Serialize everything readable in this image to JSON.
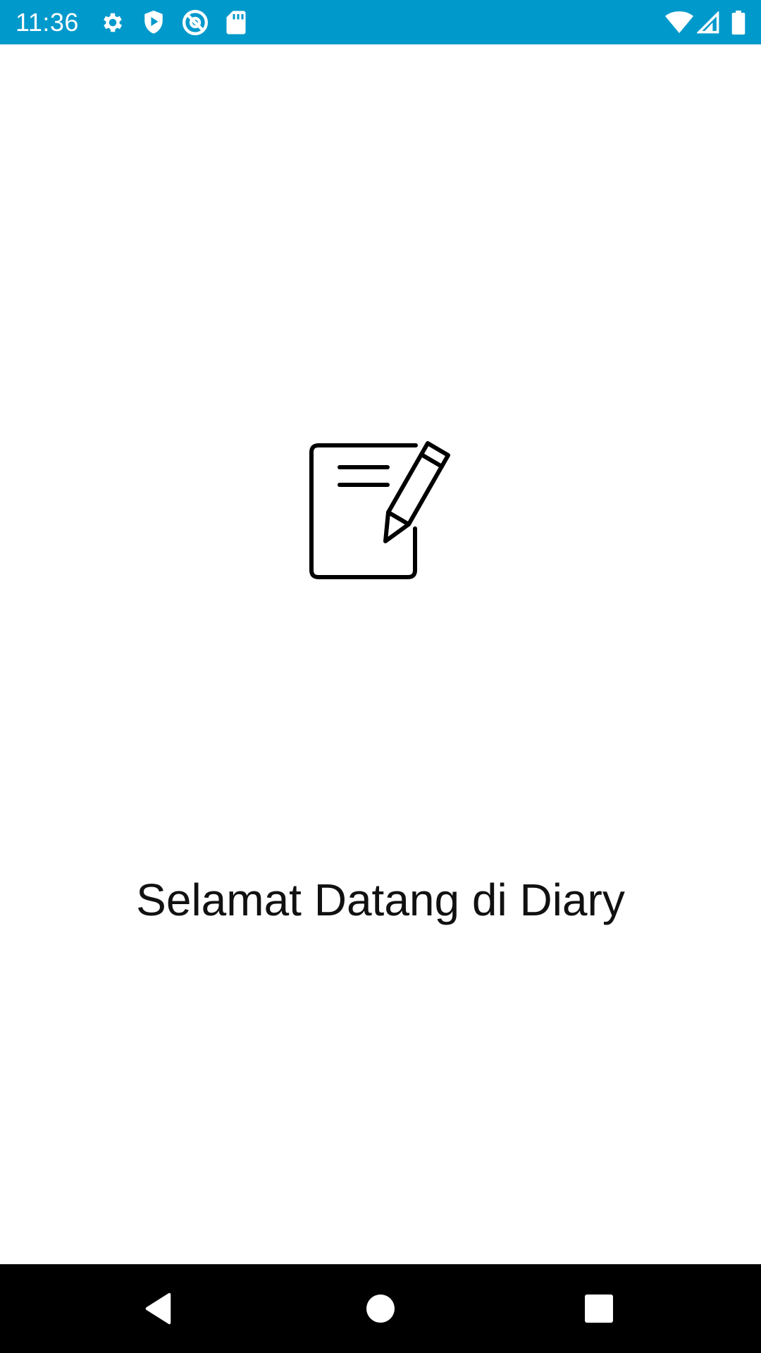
{
  "status_bar": {
    "time": "11:36",
    "background_color": "#0099cc",
    "left_icons": [
      "gear-icon",
      "shield-play-icon",
      "at-sign-icon",
      "sd-card-icon"
    ],
    "right_icons": [
      "wifi-icon",
      "signal-icon",
      "battery-icon"
    ]
  },
  "main": {
    "logo_icon": "notepad-pencil-icon",
    "welcome_text": "Selamat Datang di Diary"
  },
  "nav_bar": {
    "buttons": [
      "back-icon",
      "home-icon",
      "recents-icon"
    ]
  }
}
